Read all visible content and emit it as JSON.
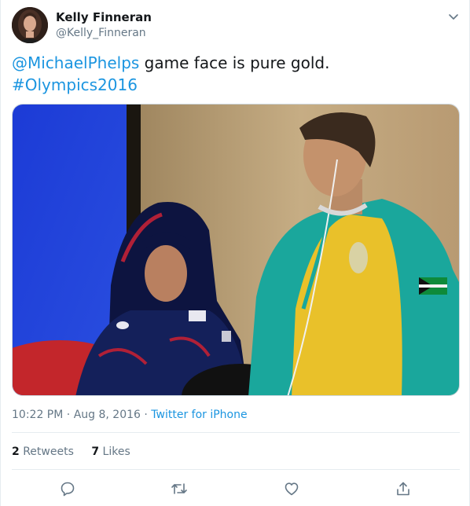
{
  "author": {
    "display_name": "Kelly Finneran",
    "handle": "@Kelly_Finneran"
  },
  "tweet": {
    "mention": "@MichaelPhelps",
    "text": " game face is pure gold.",
    "hashtag": "#Olympics2016"
  },
  "meta": {
    "time": "10:22 PM",
    "sep1": " · ",
    "date": "Aug 8, 2016",
    "sep2": " · ",
    "source": "Twitter for iPhone"
  },
  "stats": {
    "retweets_count": "2",
    "retweets_label": "Retweets",
    "likes_count": "7",
    "likes_label": "Likes"
  },
  "icons": {
    "caret": "chevron-down-icon",
    "reply": "reply-icon",
    "retweet": "retweet-icon",
    "like": "heart-icon",
    "share": "share-icon"
  },
  "colors": {
    "link": "#1b95e0",
    "muted": "#657786",
    "text": "#14171a"
  }
}
